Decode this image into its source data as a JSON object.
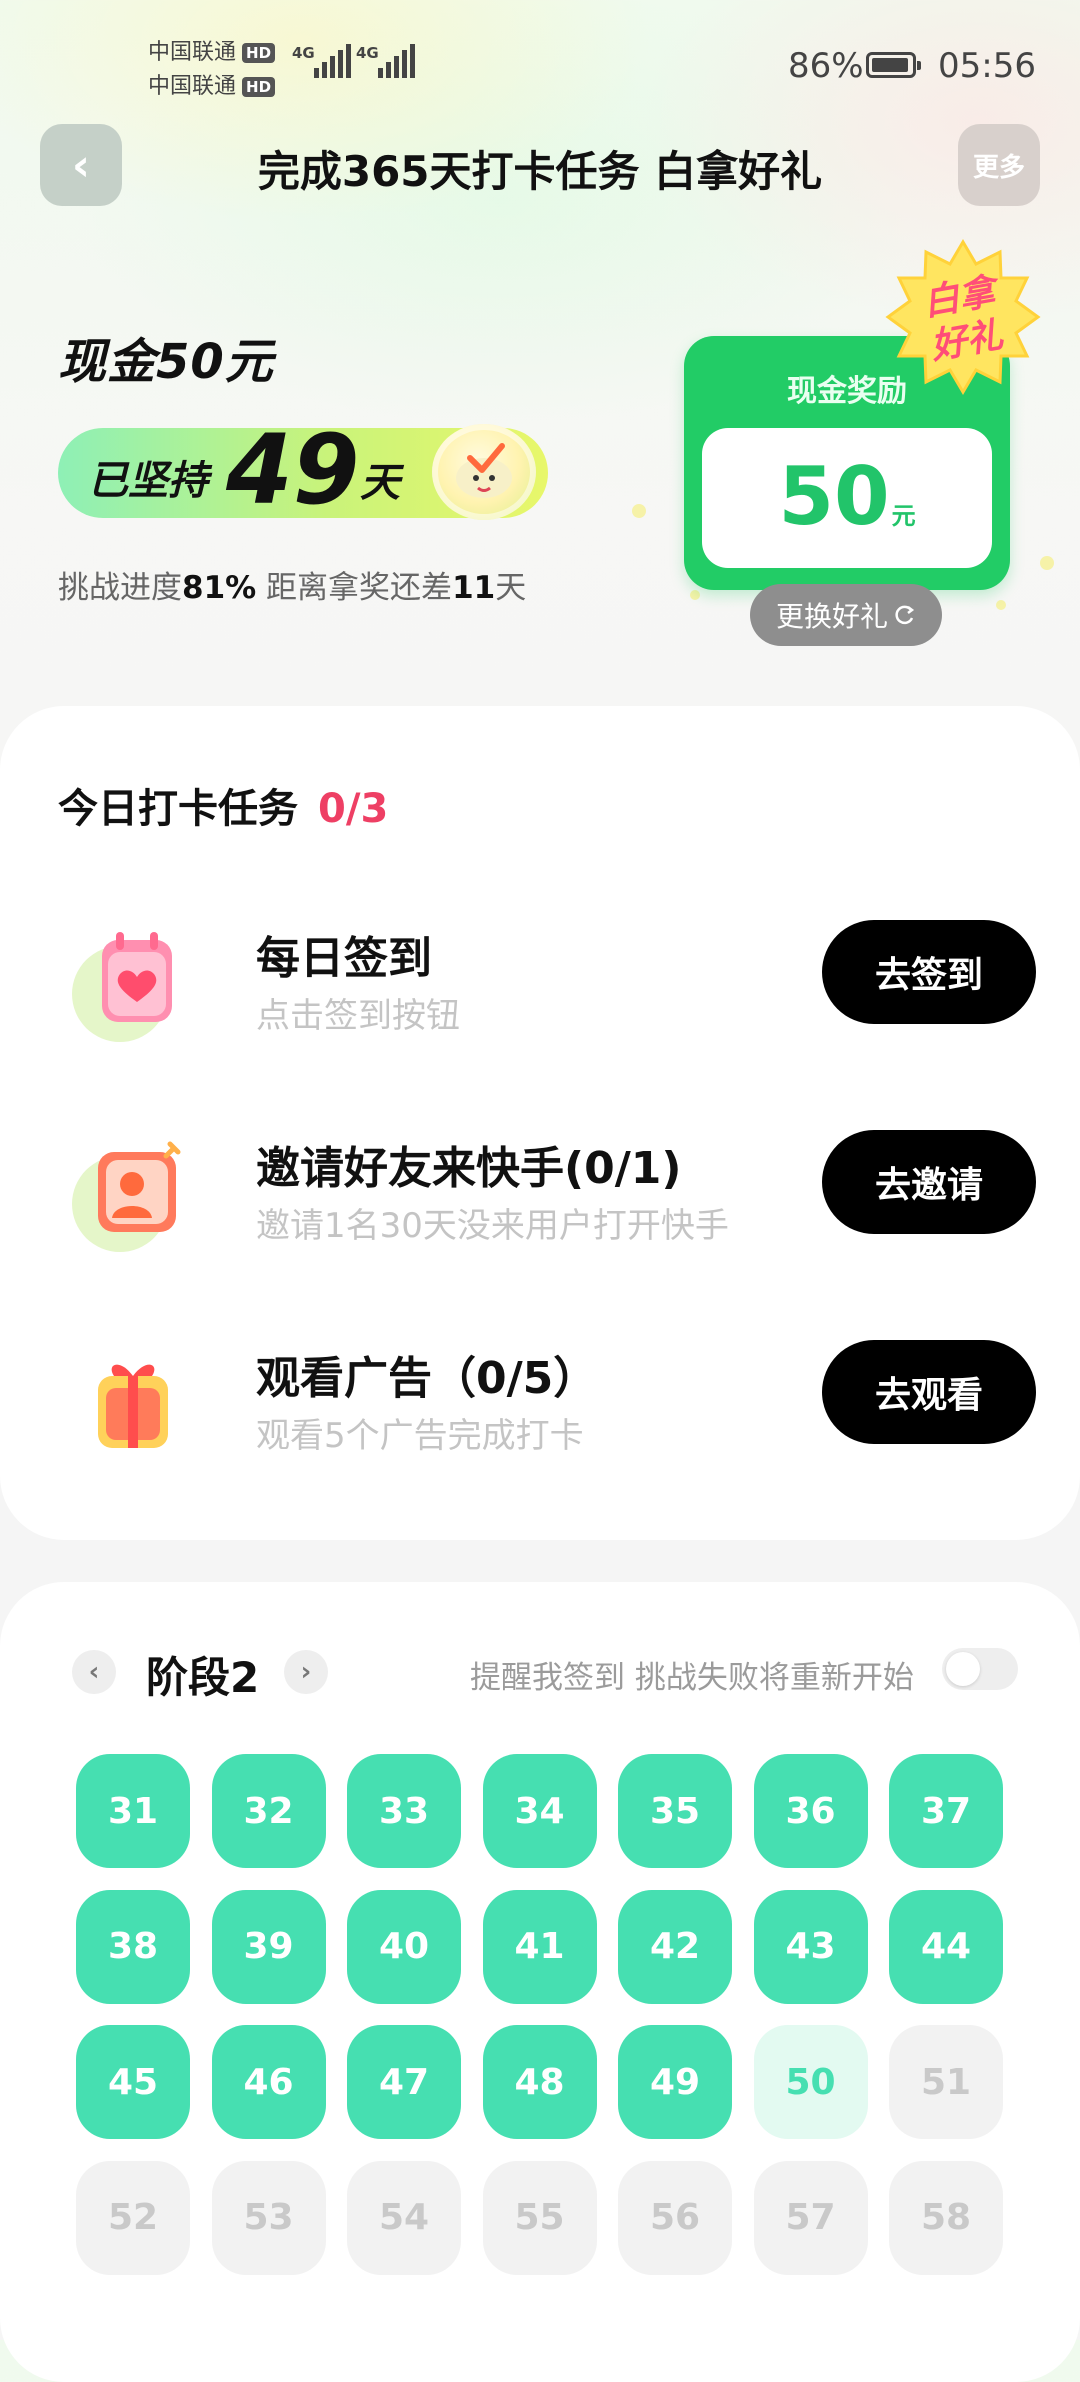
{
  "status_bar": {
    "carrier_1": "中国联通",
    "carrier_2": "中国联通",
    "hd": "HD",
    "network_1": "4G",
    "network_2": "4G",
    "battery_pct": "86%",
    "time": "05:56"
  },
  "header": {
    "back_glyph": "‹",
    "title": "完成365天打卡任务 白拿好礼",
    "more_label": "更多"
  },
  "summary": {
    "cash_title": "现金50元",
    "streak_prefix": "已坚持",
    "streak_days": "49",
    "streak_unit": "天",
    "progress_prefix": "挑战进度",
    "progress_value": "81%",
    "remaining_prefix": " 距离拿奖还差",
    "remaining_value": "11",
    "remaining_unit": "天"
  },
  "reward": {
    "label": "现金奖励",
    "amount": "50",
    "unit": "元",
    "badge_line1": "白拿",
    "badge_line2": "好礼",
    "change_label": "更换好礼",
    "change_icon": "refresh-icon",
    "accent_color": "#22cc66"
  },
  "tasks": {
    "heading": "今日打卡任务",
    "count": "0/3",
    "items": [
      {
        "title": "每日签到",
        "desc": "点击签到按钮",
        "button": "去签到",
        "icon": "calendar-heart-icon"
      },
      {
        "title": "邀请好友来快手(0/1)",
        "desc": "邀请1名30天没来用户打开快手",
        "button": "去邀请",
        "icon": "invite-user-icon"
      },
      {
        "title": "观看广告（0/5）",
        "desc": "观看5个广告完成打卡",
        "button": "去观看",
        "icon": "gift-box-icon"
      }
    ]
  },
  "calendar": {
    "stage_label": "阶段2",
    "prev_glyph": "‹",
    "next_glyph": "›",
    "remind_text": "提醒我签到 挑战失败将重新开始",
    "remind_on": false,
    "completed_color": "#46dfb1",
    "days": [
      {
        "n": "31",
        "state": "done"
      },
      {
        "n": "32",
        "state": "done"
      },
      {
        "n": "33",
        "state": "done"
      },
      {
        "n": "34",
        "state": "done"
      },
      {
        "n": "35",
        "state": "done"
      },
      {
        "n": "36",
        "state": "done"
      },
      {
        "n": "37",
        "state": "done"
      },
      {
        "n": "38",
        "state": "done"
      },
      {
        "n": "39",
        "state": "done"
      },
      {
        "n": "40",
        "state": "done"
      },
      {
        "n": "41",
        "state": "done"
      },
      {
        "n": "42",
        "state": "done"
      },
      {
        "n": "43",
        "state": "done"
      },
      {
        "n": "44",
        "state": "done"
      },
      {
        "n": "45",
        "state": "done"
      },
      {
        "n": "46",
        "state": "done"
      },
      {
        "n": "47",
        "state": "done"
      },
      {
        "n": "48",
        "state": "done"
      },
      {
        "n": "49",
        "state": "done"
      },
      {
        "n": "50",
        "state": "today"
      },
      {
        "n": "51",
        "state": "future"
      },
      {
        "n": "52",
        "state": "future"
      },
      {
        "n": "53",
        "state": "future"
      },
      {
        "n": "54",
        "state": "future"
      },
      {
        "n": "55",
        "state": "future"
      },
      {
        "n": "56",
        "state": "future"
      },
      {
        "n": "57",
        "state": "future"
      },
      {
        "n": "58",
        "state": "future"
      }
    ]
  }
}
